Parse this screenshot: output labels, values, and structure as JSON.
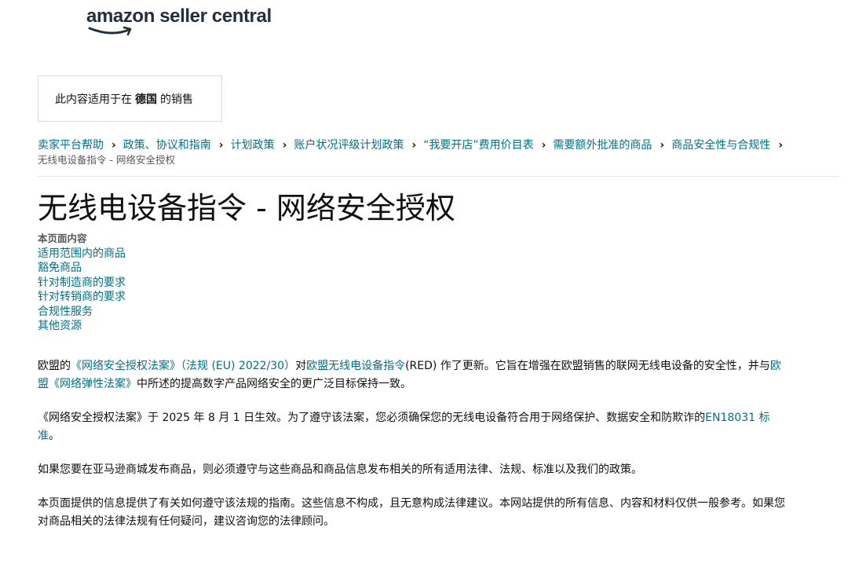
{
  "logo": {
    "text": "amazon seller central"
  },
  "notice": {
    "prefix": "此内容适用于在",
    "country": "德国",
    "suffix": "的销售"
  },
  "breadcrumb": {
    "items": [
      "卖家平台帮助",
      "政策、协议和指南",
      "计划政策",
      "账户状况评级计划政策",
      "“我要开店”费用价目表",
      "需要额外批准的商品",
      "商品安全性与合规性"
    ],
    "current": "无线电设备指令 - 网络安全授权"
  },
  "page": {
    "title": "无线电设备指令 - 网络安全授权"
  },
  "toc": {
    "heading": "本页面内容",
    "items": [
      "适用范围内的商品",
      "豁免商品",
      "针对制造商的要求",
      "针对转销商的要求",
      "合规性服务",
      "其他资源"
    ]
  },
  "content": {
    "p1": {
      "t1": "欧盟的",
      "link1": "《网络安全授权法案》（法规 (EU) 2022/30）",
      "t2": "对",
      "link2": "欧盟无线电设备指令",
      "t3": "(RED) 作了更新。它旨在增强在欧盟销售的联网无线电设备的安全性，并与",
      "link3": "欧盟《网络弹性法案》",
      "t4": "中所述的提高数字产品网络安全的更广泛目标保持一致。"
    },
    "p2": {
      "t1": "《网络安全授权法案》于 2025 年 8 月 1 日生效。为了遵守该法案，您必须确保您的无线电设备符合用于网络保护、数据安全和防欺诈的",
      "link1": "EN18031 标准",
      "t2": "。"
    },
    "p3": "如果您要在亚马逊商城发布商品，则必须遵守与这些商品和商品信息发布相关的所有适用法律、法规、标准以及我们的政策。",
    "p4": "本页面提供的信息提供了有关如何遵守该法规的指南。这些信息不构成，且无意构成法律建议。本网站提供的所有信息、内容和材料仅供一般参考。如果您对商品相关的法律法规有任何疑问，建议咨询您的法律顾问。"
  },
  "colors": {
    "link": "#007185",
    "text": "#0f1111",
    "logo": "#232f3e",
    "smile": "#ff9900"
  }
}
